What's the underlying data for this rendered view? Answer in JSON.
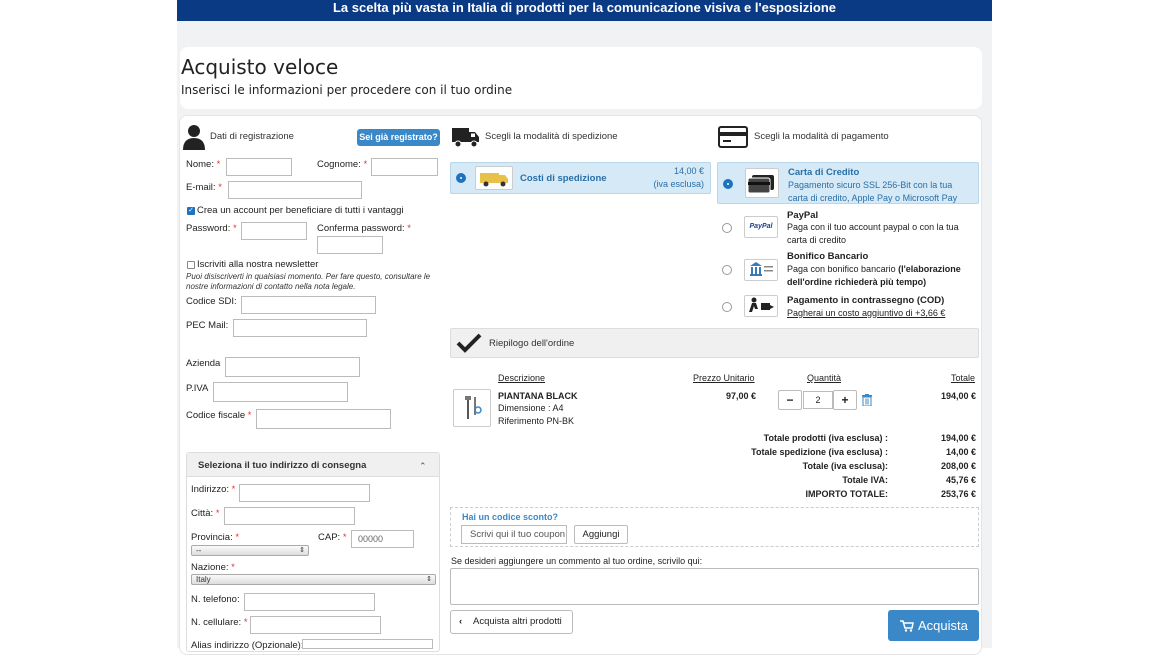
{
  "topbar": {
    "text": "La scelta più vasta in Italia di prodotti per la comunicazione visiva e l'esposizione"
  },
  "header": {
    "title": "Acquisto veloce",
    "subtitle": "Inserisci le informazioni per procedere con il tuo ordine"
  },
  "registration": {
    "title": "Dati di registrazione",
    "login_button": "Sei già registrato?",
    "nome_label": "Nome:",
    "cognome_label": "Cognome:",
    "email_label": "E-mail:",
    "create_account_label": "Crea un account per beneficiare di tutti i vantaggi",
    "password_label": "Password:",
    "confirm_password_label": "Conferma password:",
    "newsletter_label": "Iscriviti alla nostra newsletter",
    "newsletter_note": "Puoi disiscriverti in qualsiasi momento. Per fare questo, consultare le nostre informazioni di contatto nella nota legale.",
    "sdi_label": "Codice SDI:",
    "pec_label": "PEC Mail:",
    "azienda_label": "Azienda",
    "piva_label": "P.IVA",
    "cf_label": "Codice fiscale",
    "required_mark": "*"
  },
  "address": {
    "title": "Seleziona il tuo indirizzo di consegna",
    "collapse_glyph": "⌃",
    "indirizzo_label": "Indirizzo:",
    "citta_label": "Città:",
    "provincia_label": "Provincia:",
    "provincia_value": "--",
    "cap_label": "CAP:",
    "cap_placeholder": "00000",
    "nazione_label": "Nazione:",
    "nazione_value": "Italy",
    "telefono_label": "N. telefono:",
    "cellulare_label": "N. cellulare:",
    "alias_label": "Alias indirizzo (Opzionale):"
  },
  "shipping": {
    "title": "Scegli la modalità di spedizione",
    "option_label": "Costi di spedizione",
    "option_price": "14,00 €",
    "option_note": "(iva esclusa)"
  },
  "payment": {
    "title": "Scegli la modalità di pagamento",
    "methods": [
      {
        "title": "Carta di Credito",
        "desc": "Pagamento sicuro SSL 256-Bit con la tua carta di credito, Apple Pay o Microsoft Pay",
        "icon": "credit-card-icon",
        "selected": true
      },
      {
        "title": "PayPal",
        "desc": "Paga con il tuo account paypal o con la tua carta di credito",
        "icon": "paypal-icon",
        "selected": false
      },
      {
        "title": "Bonifico Bancario",
        "desc_a": "Paga con bonifico bancario ",
        "desc_b": "(l'elaborazione dell'ordine richiederà più tempo)",
        "icon": "bank-icon",
        "selected": false
      },
      {
        "title": "Pagamento in contrassegno (COD)",
        "desc": "Pagherai un costo aggiuntivo di +3,66 €",
        "icon": "cash-on-delivery-icon",
        "selected": false
      }
    ],
    "paypal_text": "PayPal"
  },
  "summary": {
    "title": "Riepilogo dell'ordine",
    "columns": {
      "description": "Descrizione",
      "unit_price": "Prezzo Unitario",
      "quantity": "Quantità",
      "total": "Totale"
    },
    "item": {
      "name": "PIANTANA BLACK",
      "dimension": "Dimensione : A4",
      "reference": "Riferimento PN-BK",
      "unit_price": "97,00 €",
      "quantity": "2",
      "total": "194,00 €"
    },
    "minus": "−",
    "plus": "+",
    "totals": [
      {
        "label": "Totale prodotti  (iva esclusa) :",
        "value": "194,00 €"
      },
      {
        "label": "Totale spedizione  (iva esclusa) :",
        "value": "14,00 €"
      },
      {
        "label": "Totale  (iva esclusa):",
        "value": "208,00 €"
      },
      {
        "label": "Totale IVA:",
        "value": "45,76 €"
      },
      {
        "label": "IMPORTO TOTALE:",
        "value": "253,76 €"
      }
    ]
  },
  "discount": {
    "title": "Hai un codice sconto?",
    "placeholder": "Scrivi qui il tuo coupon",
    "apply_button": "Aggiungi"
  },
  "comment": {
    "label": "Se desideri aggiungere un commento al tuo ordine, scrivilo qui:"
  },
  "actions": {
    "back_button": "Acquista altri prodotti",
    "buy_button": "Acquista"
  },
  "colors": {
    "brand_blue": "#0b3a85",
    "accent": "#3b88c8",
    "selected_bg": "#d5e9f6"
  }
}
